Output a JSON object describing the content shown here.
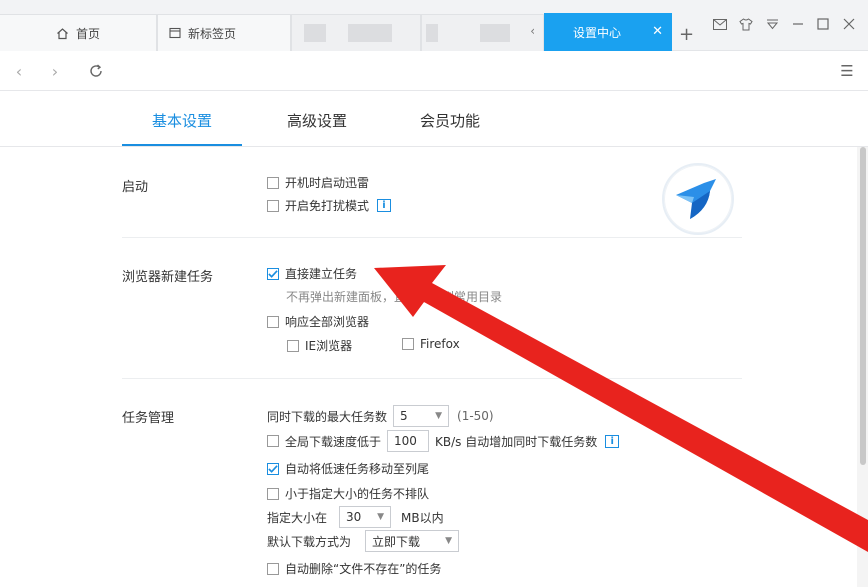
{
  "tabs": {
    "home": "首页",
    "new_tab": "新标签页",
    "active": "设置中心"
  },
  "settings_tabs": [
    "基本设置",
    "高级设置",
    "会员功能"
  ],
  "startup": {
    "label": "启动",
    "opt_autostart": "开机时启动迅雷",
    "opt_dnd": "开启免打扰模式"
  },
  "browser_task": {
    "label": "浏览器新建任务",
    "opt_direct": "直接建立任务",
    "hint": "不再弹出新建面板，直接下载到常用目录",
    "opt_all_browsers": "响应全部浏览器",
    "opt_ie": "IE浏览器",
    "opt_firefox": "Firefox"
  },
  "task_mgmt": {
    "label": "任务管理",
    "max_tasks_label": "同时下载的最大任务数",
    "max_tasks_value": "5",
    "max_tasks_range": "(1-50)",
    "speed_prefix": "全局下载速度低于",
    "speed_value": "100",
    "speed_suffix": "KB/s 自动增加同时下载任务数",
    "opt_move_slow": "自动将低速任务移动至列尾",
    "opt_small_no_queue": "小于指定大小的任务不排队",
    "size_prefix": "指定大小在",
    "size_value": "30",
    "size_unit": "MB以内",
    "download_mode_label": "默认下载方式为",
    "download_mode_value": "立即下载",
    "opt_auto_delete": "自动删除“文件不存在”的任务"
  },
  "colors": {
    "accent": "#1a8ee0",
    "active_tab": "#1aa1f0",
    "arrow": "#e8231e"
  }
}
